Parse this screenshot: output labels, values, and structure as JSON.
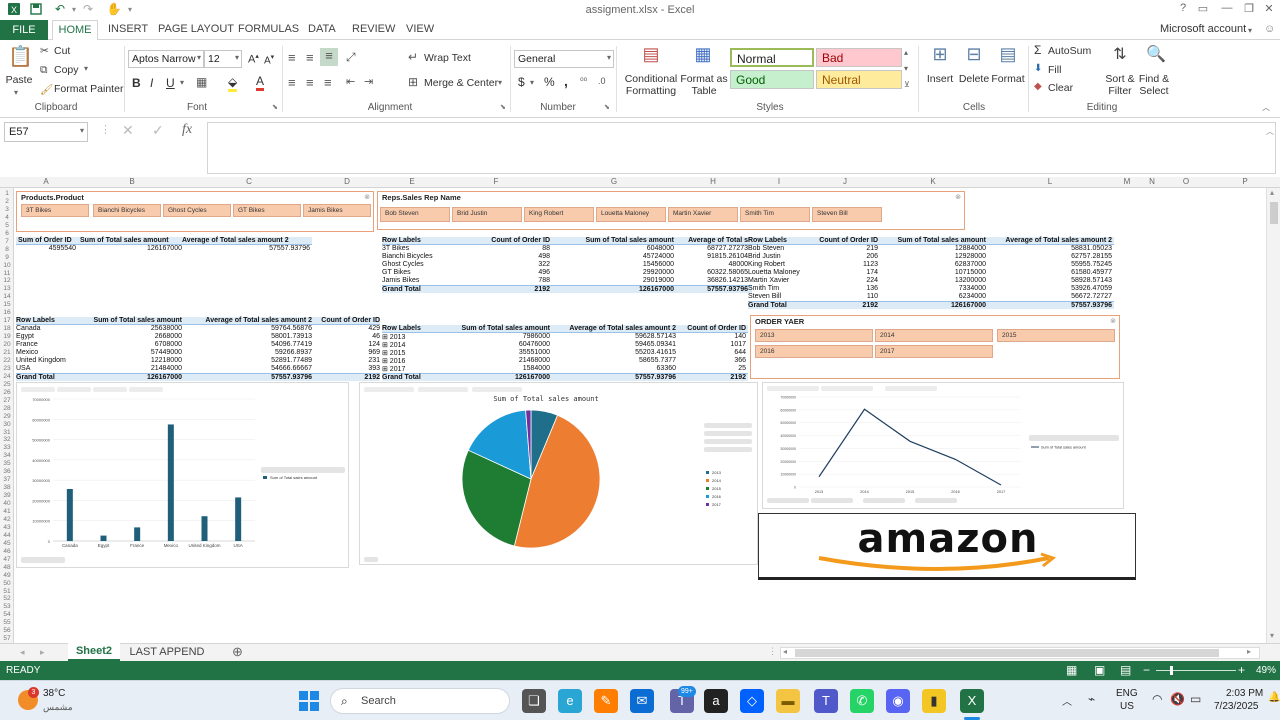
{
  "window": {
    "doc_title": "assigment.xlsx - Excel",
    "account": "Microsoft account",
    "help_icon": "question-icon",
    "minimize_icon": "minimize-icon",
    "restore_icon": "restore-icon",
    "close_icon": "close-icon"
  },
  "quick_access": {
    "save_icon": "save-icon",
    "undo_icon": "undo-icon",
    "redo_icon": "redo-icon",
    "touch_icon": "touch-mode-icon"
  },
  "ribbon_tabs": [
    "FILE",
    "HOME",
    "INSERT",
    "PAGE LAYOUT",
    "FORMULAS",
    "DATA",
    "REVIEW",
    "VIEW"
  ],
  "ribbon": {
    "clipboard": {
      "paste": "Paste",
      "cut": "Cut",
      "copy": "Copy",
      "format_painter": "Format Painter",
      "label": "Clipboard"
    },
    "font": {
      "name": "Aptos Narrow",
      "size": "12",
      "bold": "B",
      "italic": "I",
      "underline": "U",
      "label": "Font"
    },
    "alignment": {
      "wrap_text": "Wrap Text",
      "merge_center": "Merge & Center",
      "label": "Alignment"
    },
    "number": {
      "format": "General",
      "currency": "$",
      "percent": "%",
      "comma": ",",
      "label": "Number"
    },
    "styles": {
      "conditional": "Conditional Formatting",
      "format_as_table": "Format as Table",
      "normal": "Normal",
      "bad": "Bad",
      "good": "Good",
      "neutral": "Neutral",
      "label": "Styles"
    },
    "cells": {
      "insert": "Insert",
      "delete": "Delete",
      "format": "Format",
      "label": "Cells"
    },
    "editing": {
      "autosum": "AutoSum",
      "fill": "Fill",
      "clear": "Clear",
      "sort_filter": "Sort & Filter",
      "find_select": "Find & Select",
      "label": "Editing"
    }
  },
  "formula_bar": {
    "name_box": "E57",
    "fx": "fx",
    "formula": ""
  },
  "columns": [
    "A",
    "B",
    "C",
    "D",
    "E",
    "F",
    "G",
    "H",
    "I",
    "J",
    "K",
    "L",
    "M",
    "N",
    "O",
    "P"
  ],
  "rows": [
    "1",
    "2",
    "3",
    "4",
    "5",
    "6",
    "7",
    "8",
    "9",
    "10",
    "11",
    "12",
    "13",
    "14",
    "15",
    "16",
    "17",
    "18",
    "19",
    "20",
    "21",
    "22",
    "23",
    "24",
    "25",
    "26",
    "27",
    "28",
    "29",
    "30",
    "31",
    "32",
    "33",
    "34",
    "35",
    "36",
    "37",
    "38",
    "39",
    "40",
    "41",
    "42",
    "43",
    "44",
    "45",
    "46",
    "47",
    "48",
    "49",
    "50",
    "51",
    "52",
    "53",
    "54",
    "55",
    "56",
    "57",
    "58"
  ],
  "slicers": {
    "products": {
      "title": "Products.Product",
      "items": [
        "3T Bikes",
        "Bianchi Bicycles",
        "Ghost Cycles",
        "GT Bikes",
        "Jamis Bikes"
      ]
    },
    "reps": {
      "title": "Reps.Sales Rep Name",
      "items": [
        "Bob Steven",
        "Brid Justin",
        "King Robert",
        "Louetta Maloney",
        "Martin Xavier",
        "Smith Tim",
        "Steven Bill"
      ]
    },
    "order_year": {
      "title": "ORDER YAER",
      "items": [
        "2013",
        "2014",
        "2015",
        "2016",
        "2017"
      ]
    }
  },
  "pivot_summary": {
    "headers": [
      "Sum of Order ID",
      "Sum of Total sales amount",
      "Average of Total sales amount 2"
    ],
    "values": [
      "4595540",
      "126167000",
      "57557.93796"
    ]
  },
  "pivot_product": {
    "headers": [
      "Row Labels",
      "Count of Order ID",
      "Sum of Total sales amount",
      "Average of Total s"
    ],
    "rows": [
      [
        "3T Bikes",
        "88",
        "6048000",
        "68727.27273"
      ],
      [
        "Bianchi Bicycles",
        "498",
        "45724000",
        "91815.26104"
      ],
      [
        "Ghost Cycles",
        "322",
        "15456000",
        "48000"
      ],
      [
        "GT Bikes",
        "496",
        "29920000",
        "60322.58065"
      ],
      [
        "Jamis Bikes",
        "788",
        "29019000",
        "36826.14213"
      ]
    ],
    "total": [
      "Grand Total",
      "2192",
      "126167000",
      "57557.93796"
    ]
  },
  "pivot_rep": {
    "headers": [
      "Row Labels",
      "Count of Order ID",
      "Sum of Total sales amount",
      "Average of Total sales amount 2"
    ],
    "rows": [
      [
        "Bob Steven",
        "219",
        "12884000",
        "58831.05023"
      ],
      [
        "Brid Justin",
        "206",
        "12928000",
        "62757.28155"
      ],
      [
        "King Robert",
        "1123",
        "62837000",
        "55955.75245"
      ],
      [
        "Louetta Maloney",
        "174",
        "10715000",
        "61580.45977"
      ],
      [
        "Martin Xavier",
        "224",
        "13200000",
        "58928.57143"
      ],
      [
        "Smith Tim",
        "136",
        "7334000",
        "53926.47059"
      ],
      [
        "Steven Bill",
        "110",
        "6234000",
        "56672.72727"
      ]
    ],
    "total": [
      "Grand Total",
      "2192",
      "126167000",
      "57557.93796"
    ]
  },
  "pivot_country": {
    "headers": [
      "Row Labels",
      "Sum of Total sales amount",
      "Average of Total sales amount 2",
      "Count of Order ID"
    ],
    "rows": [
      [
        "Canada",
        "25638000",
        "59764.56876",
        "429"
      ],
      [
        "Egypt",
        "2668000",
        "58001.73913",
        "46"
      ],
      [
        "France",
        "6708000",
        "54096.77419",
        "124"
      ],
      [
        "Mexico",
        "57449000",
        "59266.8937",
        "969"
      ],
      [
        "United Kingdom",
        "12218000",
        "52891.77489",
        "231"
      ],
      [
        "USA",
        "21484000",
        "54666.66667",
        "393"
      ]
    ],
    "total": [
      "Grand Total",
      "126167000",
      "57557.93796",
      "2192"
    ]
  },
  "pivot_year": {
    "headers": [
      "Row Labels",
      "Sum of Total sales amount",
      "Average of Total sales amount 2",
      "Count of Order ID"
    ],
    "rows": [
      [
        "⊞ 2013",
        "7986000",
        "59628.57143",
        "140"
      ],
      [
        "⊞ 2014",
        "60476000",
        "59465.09341",
        "1017"
      ],
      [
        "⊞ 2015",
        "35551000",
        "55203.41615",
        "644"
      ],
      [
        "⊞ 2016",
        "21468000",
        "58655.7377",
        "366"
      ],
      [
        "⊞ 2017",
        "1584000",
        "63360",
        "25"
      ]
    ],
    "total": [
      "Grand Total",
      "126167000",
      "57557.93796",
      "2192"
    ]
  },
  "chart_data": [
    {
      "type": "bar",
      "title": "",
      "categories": [
        "Canada",
        "Egypt",
        "France",
        "Mexico",
        "United Kingdom",
        "USA"
      ],
      "series": [
        {
          "name": "Sum of Total sales amount",
          "values": [
            25638000,
            2668000,
            6708000,
            57449000,
            12218000,
            21484000
          ]
        }
      ],
      "ylim": [
        0,
        70000000
      ],
      "y_ticks": [
        "0",
        "10000000",
        "20000000",
        "30000000",
        "40000000",
        "50000000",
        "60000000",
        "70000000"
      ],
      "legend": "right",
      "color": "#1f5f7a"
    },
    {
      "type": "pie",
      "title": "Sum of Total sales amount",
      "categories": [
        "2013",
        "2014",
        "2015",
        "2016",
        "2017"
      ],
      "values": [
        7986000,
        60476000,
        35551000,
        21468000,
        1584000
      ],
      "colors": [
        "#1f6f8b",
        "#ed7d31",
        "#1e7d32",
        "#1a9bd7",
        "#7030a0"
      ],
      "legend": "right"
    },
    {
      "type": "line",
      "title": "",
      "categories": [
        "2013",
        "2014",
        "2015",
        "2016",
        "2017"
      ],
      "series": [
        {
          "name": "Sum of Total sales amount",
          "values": [
            7986000,
            60476000,
            35551000,
            21468000,
            1584000
          ]
        }
      ],
      "ylim": [
        0,
        70000000
      ],
      "y_ticks": [
        "0",
        "10000000",
        "20000000",
        "30000000",
        "40000000",
        "50000000",
        "60000000",
        "70000000"
      ],
      "legend": "right",
      "color": "#1f3f5f"
    }
  ],
  "logo": {
    "text": "amazon"
  },
  "sheet_tabs": [
    "Sheet2",
    "LAST APPEND"
  ],
  "status": {
    "ready": "READY",
    "zoom": "49%"
  },
  "taskbar": {
    "weather_temp": "38°C",
    "weather_desc": "مشمس",
    "search_placeholder": "Search",
    "lang1": "ENG",
    "lang2": "US",
    "time": "2:03 PM",
    "date": "7/23/2025",
    "badge": "99+"
  },
  "colors": {
    "excel_green": "#217346",
    "slicer_fill": "#f8cbad",
    "pivot_header": "#ddebf7"
  }
}
